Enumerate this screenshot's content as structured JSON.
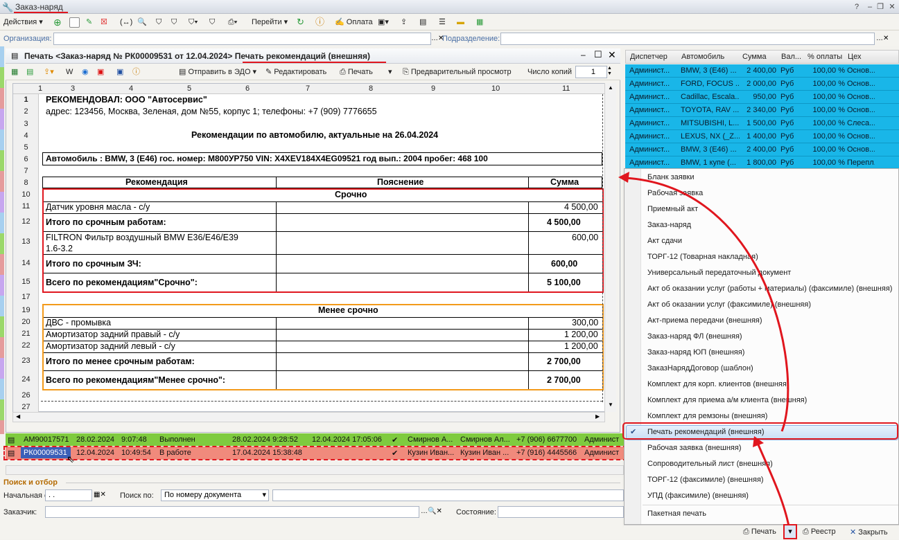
{
  "window": {
    "title": "Заказ-наряд"
  },
  "toolbar": {
    "actions": "Действия",
    "go": "Перейти",
    "payment": "Оплата"
  },
  "filter": {
    "org_label": "Организация:",
    "dept_label": "Подразделение:"
  },
  "grid": {
    "headers": [
      "Диспетчер",
      "Автомобиль",
      "Сумма",
      "Вал...",
      "% оплаты",
      "Цех"
    ],
    "rows": [
      [
        "Админист...",
        "BMW, 3 (E46) ...",
        "2 400,00",
        "Руб",
        "100,00 %",
        "Основ..."
      ],
      [
        "Админист...",
        "FORD, FOCUS ...",
        "2 000,00",
        "Руб",
        "100,00 %",
        "Основ..."
      ],
      [
        "Админист...",
        "Cadillac, Escala...",
        "950,00",
        "Руб",
        "100,00 %",
        "Основ..."
      ],
      [
        "Админист...",
        "TOYOTA, RAV ...",
        "2 340,00",
        "Руб",
        "100,00 %",
        "Основ..."
      ],
      [
        "Админист...",
        "MITSUBISHI, L...",
        "1 500,00",
        "Руб",
        "100,00 %",
        "Слеса..."
      ],
      [
        "Админист...",
        "LEXUS, NX (_Z...",
        "1 400,00",
        "Руб",
        "100,00 %",
        "Основ..."
      ],
      [
        "Админист...",
        "BMW, 3 (E46) ...",
        "2 400,00",
        "Руб",
        "100,00 %",
        "Основ..."
      ],
      [
        "Админист...",
        "BMW, 1 купе (...",
        "1 800,00",
        "Руб",
        "100,00 %",
        "Перепл..."
      ]
    ]
  },
  "print_window": {
    "title_prefix": "Печать <Заказ-наряд № РК00009531 от 12.04.2024>",
    "title_suffix": "Печать рекомендаций (внешняя)",
    "send_edo": "Отправить в ЭДО",
    "edit": "Редактировать",
    "print": "Печать",
    "preview": "Предварительный просмотр",
    "copies_label": "Число копий",
    "copies": "1"
  },
  "sheet": {
    "col_headers": [
      "1",
      "3",
      "4",
      "5",
      "6",
      "7",
      "8",
      "9",
      "10",
      "11"
    ],
    "row_numbers": [
      "1",
      "2",
      "3",
      "4",
      "5",
      "6",
      "7",
      "8",
      "10",
      "11",
      "12",
      "13",
      "14",
      "15",
      "17",
      "19",
      "20",
      "21",
      "22",
      "23",
      "24",
      "26",
      "27"
    ],
    "recommender": "РЕКОМЕНДОВАЛ:  ООО \"Автосервис\"",
    "address": "адрес: 123456, Москва, Зеленая, дом №55, корпус 1; телефоны: +7 (909) 7776655",
    "heading": "Рекомендации по автомобилю, актуальные на 26.04.2024",
    "car": "Автомобиль : BMW, 3 (E46)  гос. номер:  М800УР750   VIN: X4XEV184X4EG09521 год вып.: 2004 пробег: 468 100",
    "col_rec": "Рекомендация",
    "col_expl": "Пояснение",
    "col_sum": "Сумма",
    "urgent": "Срочно",
    "r11": "Датчик уровня масла - с/у",
    "r11_sum": "4 500,00",
    "r12": "Итого по срочным работам:",
    "r12_sum": "4 500,00",
    "r13a": "FILTRON   Фильтр   воздушный   BMW   E36/E46/E39",
    "r13b": "1.6-3.2",
    "r13_sum": "600,00",
    "r14": "Итого по срочным ЗЧ:",
    "r14_sum": "600,00",
    "r15": "Всего по рекомендациям\"Срочно\":",
    "r15_sum": "5 100,00",
    "less": "Менее срочно",
    "r20": "ДВС - промывка",
    "r20_sum": "300,00",
    "r21": "Амортизатор задний правый - с/у",
    "r21_sum": "1 200,00",
    "r22": "Амортизатор задний левый - с/у",
    "r22_sum": "1 200,00",
    "r23": "Итого по менее срочным работам:",
    "r23_sum": "2 700,00",
    "r24": "Всего по рекомендациям\"Менее срочно\":",
    "r24_sum": "2 700,00"
  },
  "list": {
    "row1": [
      "АМ90017571",
      "28.02.2024",
      "9:07:48",
      "Выполнен",
      "28.02.2024 9:28:52",
      "12.04.2024 17:05:06",
      "✔",
      "Смирнов А...",
      "Смирнов Ал...",
      "+7 (906) 6677700",
      "Админист"
    ],
    "row2": [
      "РК00009531",
      "12.04.2024",
      "10:49:54",
      "В работе",
      "17.04.2024 15:38:48",
      "",
      "✔",
      "Кузин Иван...",
      "Кузин Иван ...",
      "+7 (916) 4445566",
      "Админист"
    ]
  },
  "search": {
    "title": "Поиск и отбор",
    "start_label": "Начальная с:",
    "start_value": " .  .",
    "search_by_label": "Поиск по:",
    "search_by_value": "По номеру документа",
    "customer_label": "Заказчик:",
    "state_label": "Состояние:"
  },
  "menu": {
    "items": [
      "Бланк заявки",
      "Рабочая заявка",
      "Приемный акт",
      "Заказ-наряд",
      "Акт сдачи",
      "ТОРГ-12 (Товарная накладная)",
      "Универсальный передаточный документ",
      "Акт об оказании услуг (работы + материалы) (факсимиле) (внешняя)",
      "Акт об оказании услуг (факсимиле) (внешняя)",
      "Акт-приема передачи (внешняя)",
      "Заказ-наряд ФЛ (внешняя)",
      "Заказ-наряд ЮП (внешняя)",
      "ЗаказНарядДоговор (шаблон)",
      "Комплект для корп. клиентов (внешняя)",
      "Комплект для приема а/м клиента  (внешняя)",
      "Комплект для ремзоны (внешняя)",
      "Печать рекомендаций (внешняя)",
      "Рабочая заявка (внешняя)",
      "Сопроводительный лист  (внешняя)",
      "ТОРГ-12 (факсимиле) (внешняя)",
      "УПД (факсимиле) (внешняя)",
      "Пакетная печать"
    ]
  },
  "bottombar": {
    "print": "Печать",
    "registry": "Реестр",
    "close": "Закрыть"
  },
  "colors": {
    "accent_red": "#e0161e",
    "row_blue": "#19b6e8",
    "row_green": "#7fcb3f",
    "row_red": "#f08a7c",
    "orange": "#f39a1a"
  }
}
